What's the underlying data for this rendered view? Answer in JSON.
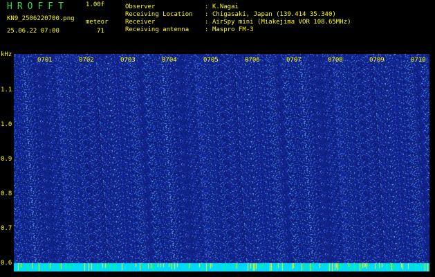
{
  "header": {
    "title": "HROFFT",
    "version": "1.00f",
    "filename": "KN9_2506220700.png",
    "meteor_label": "meteor",
    "datetime": "25.06.22 07:00",
    "meteor_count": "71"
  },
  "info": [
    {
      "label": "Observer",
      "value": "K.Nagai"
    },
    {
      "label": "Receiving Location",
      "value": "Chigasaki, Japan (139.414 35.340)"
    },
    {
      "label": "Receiver",
      "value": "AirSpy mini (Miakejima VOR 108.65MHz)"
    },
    {
      "label": "Receiving antenna",
      "value": "Maspro FM-3"
    }
  ],
  "spectrogram": {
    "y_unit": "kHz",
    "y_ticks": [
      "1.1",
      "1.0",
      "0.9",
      "0.8",
      "0.7",
      "0.6"
    ],
    "x_ticks": [
      "0701",
      "0702",
      "0703",
      "0704",
      "0705",
      "0706",
      "0707",
      "0708",
      "0709",
      "0710"
    ],
    "colors": {
      "background": "#101a78",
      "noise_low": "#1830a8",
      "noise_high": "#4a78ff",
      "carrier": "#6ee8ff",
      "label": "#ffff00",
      "baseline": "#00d8ff"
    }
  }
}
